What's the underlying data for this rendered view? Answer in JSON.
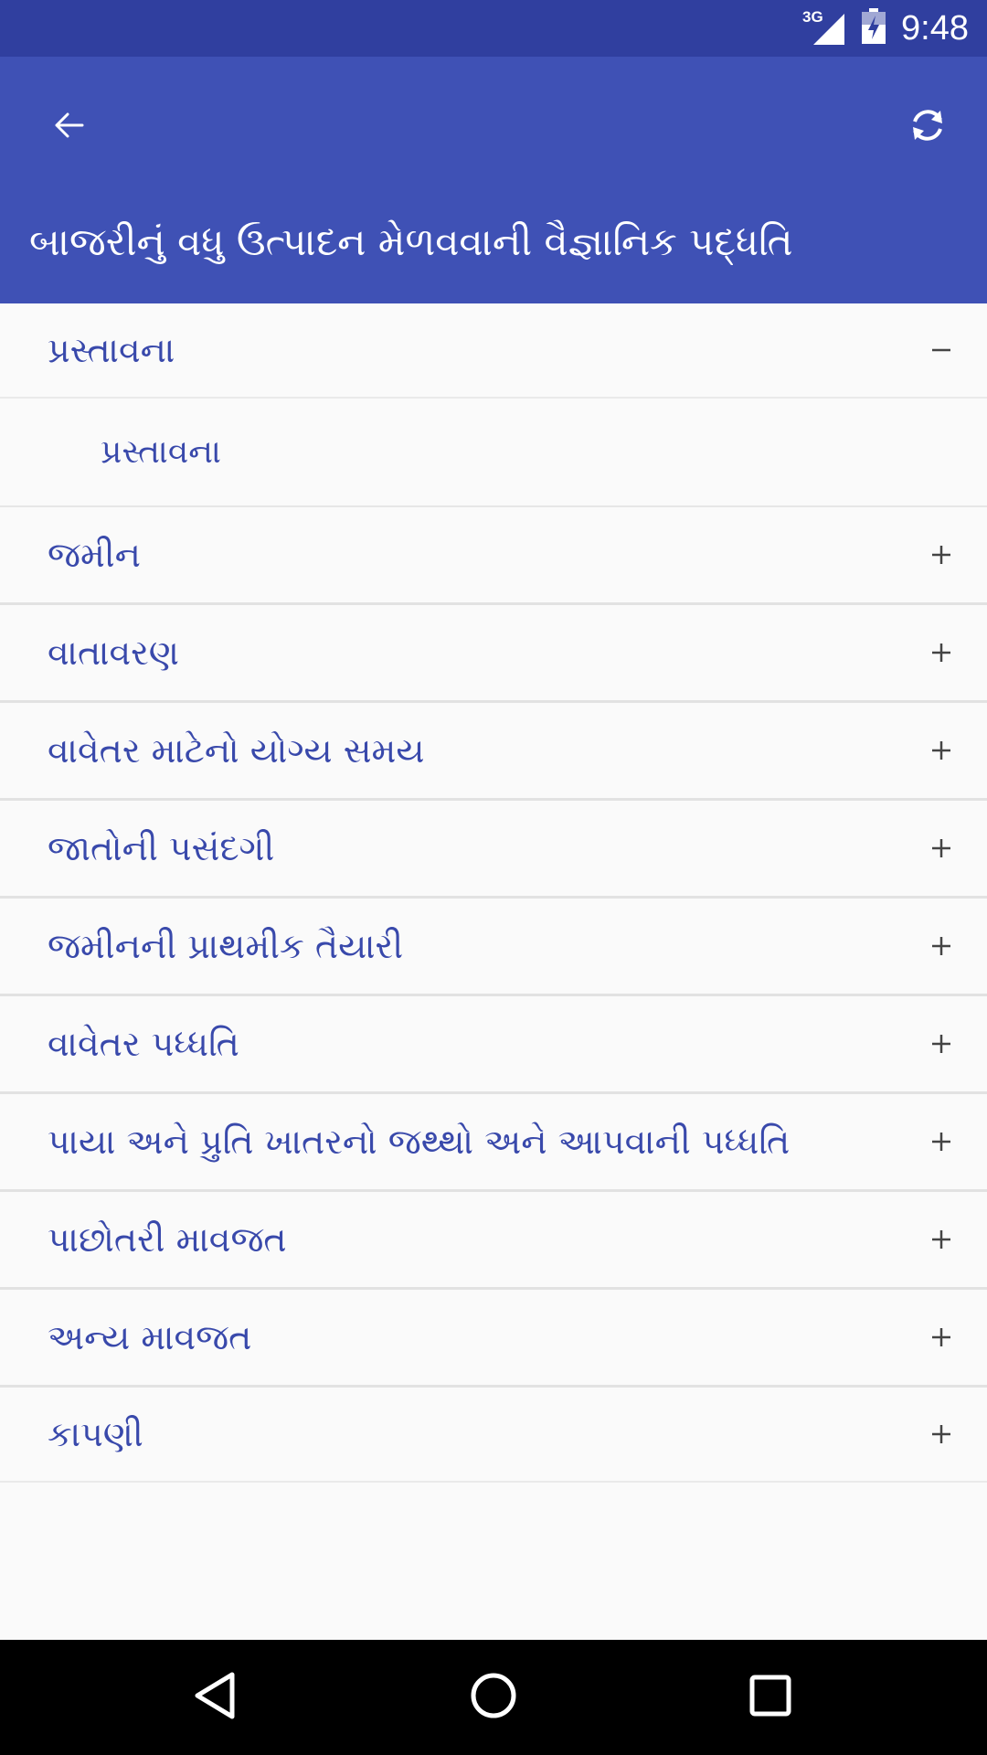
{
  "status_bar": {
    "network": "3G",
    "time": "9:48"
  },
  "app_bar": {
    "title": "બાજરીનું વધુ ઉત્પાદન મેળવવાની વૈજ્ઞાનિક પદ્ધતિ",
    "back_icon": "arrow-left-icon",
    "refresh_icon": "refresh-icon"
  },
  "sections": [
    {
      "label": "પ્રસ્તાવના",
      "expanded": true,
      "toggle": "−",
      "children": [
        "પ્રસ્તાવના"
      ]
    },
    {
      "label": "જમીન",
      "expanded": false,
      "toggle": "+"
    },
    {
      "label": "વાતાવરણ",
      "expanded": false,
      "toggle": "+"
    },
    {
      "label": "વાવેતર માટેનો યોગ્ય સમય",
      "expanded": false,
      "toggle": "+"
    },
    {
      "label": "જાતોની પસંદગી",
      "expanded": false,
      "toggle": "+"
    },
    {
      "label": "જમીનની પ્રાથમીક તૈયારી",
      "expanded": false,
      "toggle": "+"
    },
    {
      "label": "વાવેતર પધ્ધતિ",
      "expanded": false,
      "toggle": "+"
    },
    {
      "label": "પાયા અને પ્રુતિ ખાતરનો જથ્થો અને આપવાની પધ્ધતિ",
      "expanded": false,
      "toggle": "+"
    },
    {
      "label": "પાછોતરી માવજત",
      "expanded": false,
      "toggle": "+"
    },
    {
      "label": "અન્ય માવજત",
      "expanded": false,
      "toggle": "+"
    },
    {
      "label": "કાપણી",
      "expanded": false,
      "toggle": "+"
    }
  ],
  "nav_bar": {
    "back_icon": "nav-back-icon",
    "home_icon": "nav-home-icon",
    "recents_icon": "nav-recents-icon"
  },
  "colors": {
    "status_bar": "#303f9f",
    "app_bar": "#3f51b5",
    "item_text": "#3949ab",
    "background": "#fafafa"
  }
}
